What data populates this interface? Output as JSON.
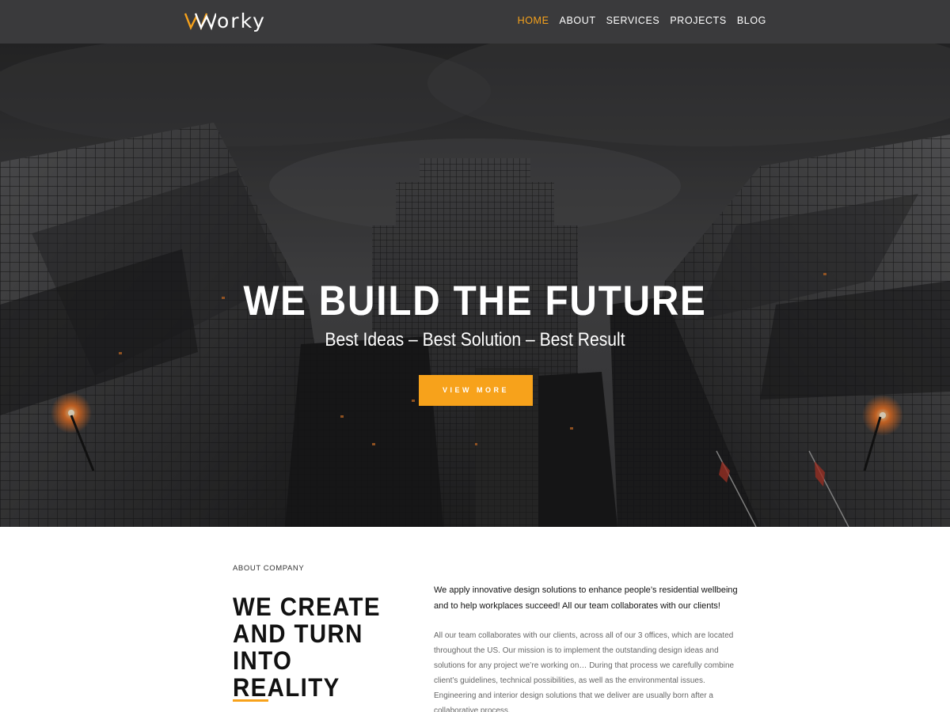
{
  "brand": {
    "name": "orky",
    "mark_icon": "worky-w-logo-icon",
    "mark_color": "#f7a21b"
  },
  "nav": {
    "items": [
      {
        "label": "HOME",
        "active": true
      },
      {
        "label": "ABOUT",
        "active": false
      },
      {
        "label": "SERVICES",
        "active": false
      },
      {
        "label": "PROJECTS",
        "active": false
      },
      {
        "label": "BLOG",
        "active": false
      }
    ]
  },
  "hero": {
    "title": "WE BUILD THE FUTURE",
    "subtitle": "Best Ideas – Best Solution – Best Result",
    "button_label": "VIEW MORE",
    "background_image": "dark-skyscrapers-photo"
  },
  "about": {
    "kicker": "ABOUT COMPANY",
    "heading_lines": [
      "WE CREATE",
      "AND TURN INTO",
      "REALITY"
    ],
    "lead": "We apply innovative design solutions to enhance people’s residential wellbeing and to help workplaces succeed! All our team collaborates with our clients!",
    "body": "All our team collaborates with our clients, across all of our 3 offices, which are located throughout the US. Our mission is to implement the outstanding design ideas and solutions for any project we’re working on… During that process we carefully combine client’s guidelines, technical possibilities, as well as the environmental issues. Engineering and interior design solutions that we deliver are usually born after a collaborative process."
  },
  "colors": {
    "accent": "#f7a21b",
    "navbar": "#3a3a3c",
    "text_dark": "#111111",
    "text_muted": "#666666"
  }
}
